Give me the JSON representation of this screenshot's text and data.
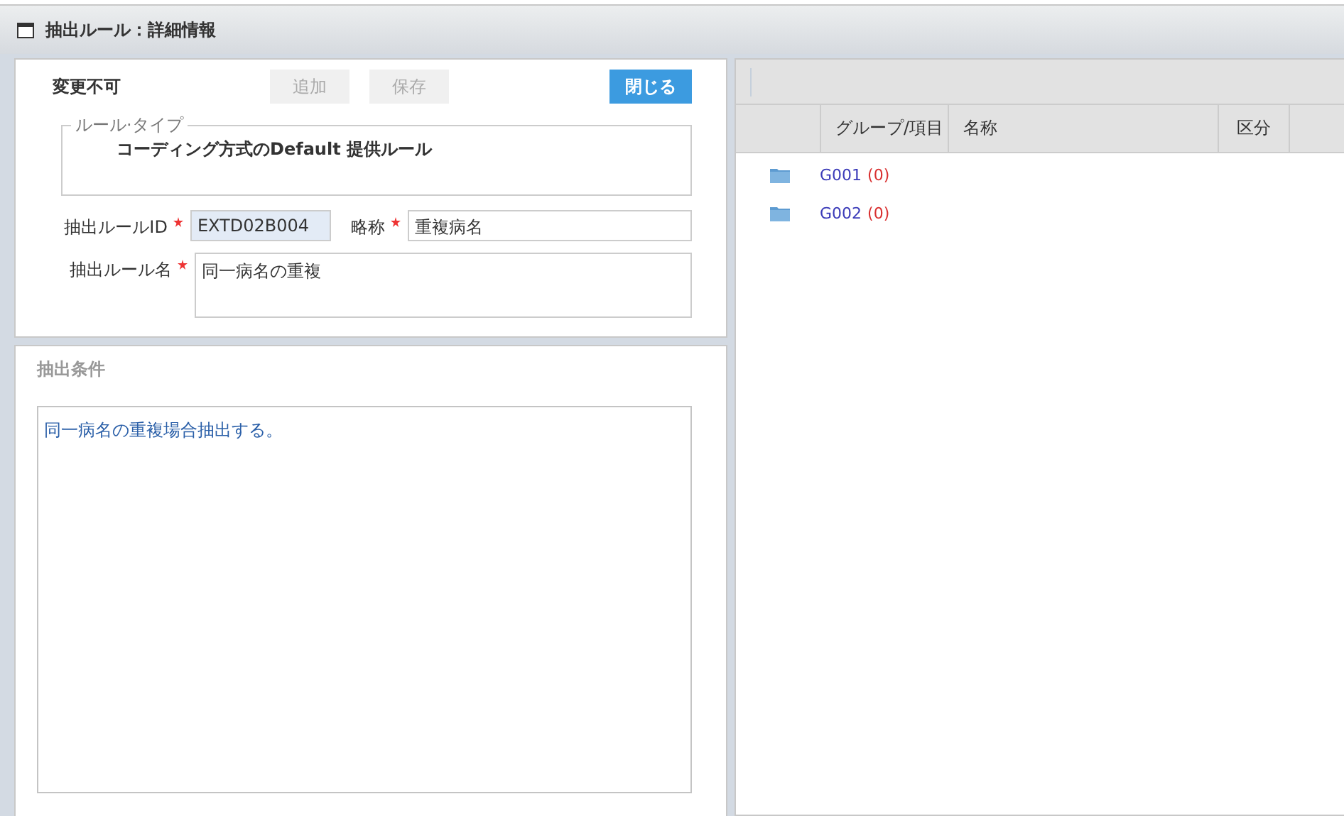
{
  "window": {
    "title": "抽出ルール：詳細情報"
  },
  "rule_panel": {
    "status": "変更不可",
    "buttons": [
      {
        "label": "追加",
        "kind": "plain",
        "disabled": true
      },
      {
        "label": "保存",
        "kind": "plain",
        "disabled": true
      },
      {
        "label": "閉じる",
        "kind": "primary",
        "disabled": false
      }
    ],
    "rule_type": {
      "legend": "ルール·タイプ",
      "value": "コーディング方式のDefault 提供ルール"
    },
    "fields": {
      "rule_id": {
        "label": "抽出ルールID",
        "required": true,
        "value": "EXTD02B004",
        "readonly": true
      },
      "short_name": {
        "label": "略称",
        "required": true,
        "value": "重複病名",
        "readonly": false
      },
      "rule_name": {
        "label": "抽出ルール名",
        "required": true,
        "value": "同一病名の重複"
      }
    }
  },
  "condition_panel": {
    "title": "抽出条件",
    "text": "同一病名の重複場合抽出する。"
  },
  "tree_table": {
    "columns": [
      "グループ/項目",
      "名称",
      "区分"
    ],
    "rows": [
      {
        "code": "G001",
        "count": "(0)"
      },
      {
        "code": "G002",
        "count": "(0)"
      }
    ]
  }
}
